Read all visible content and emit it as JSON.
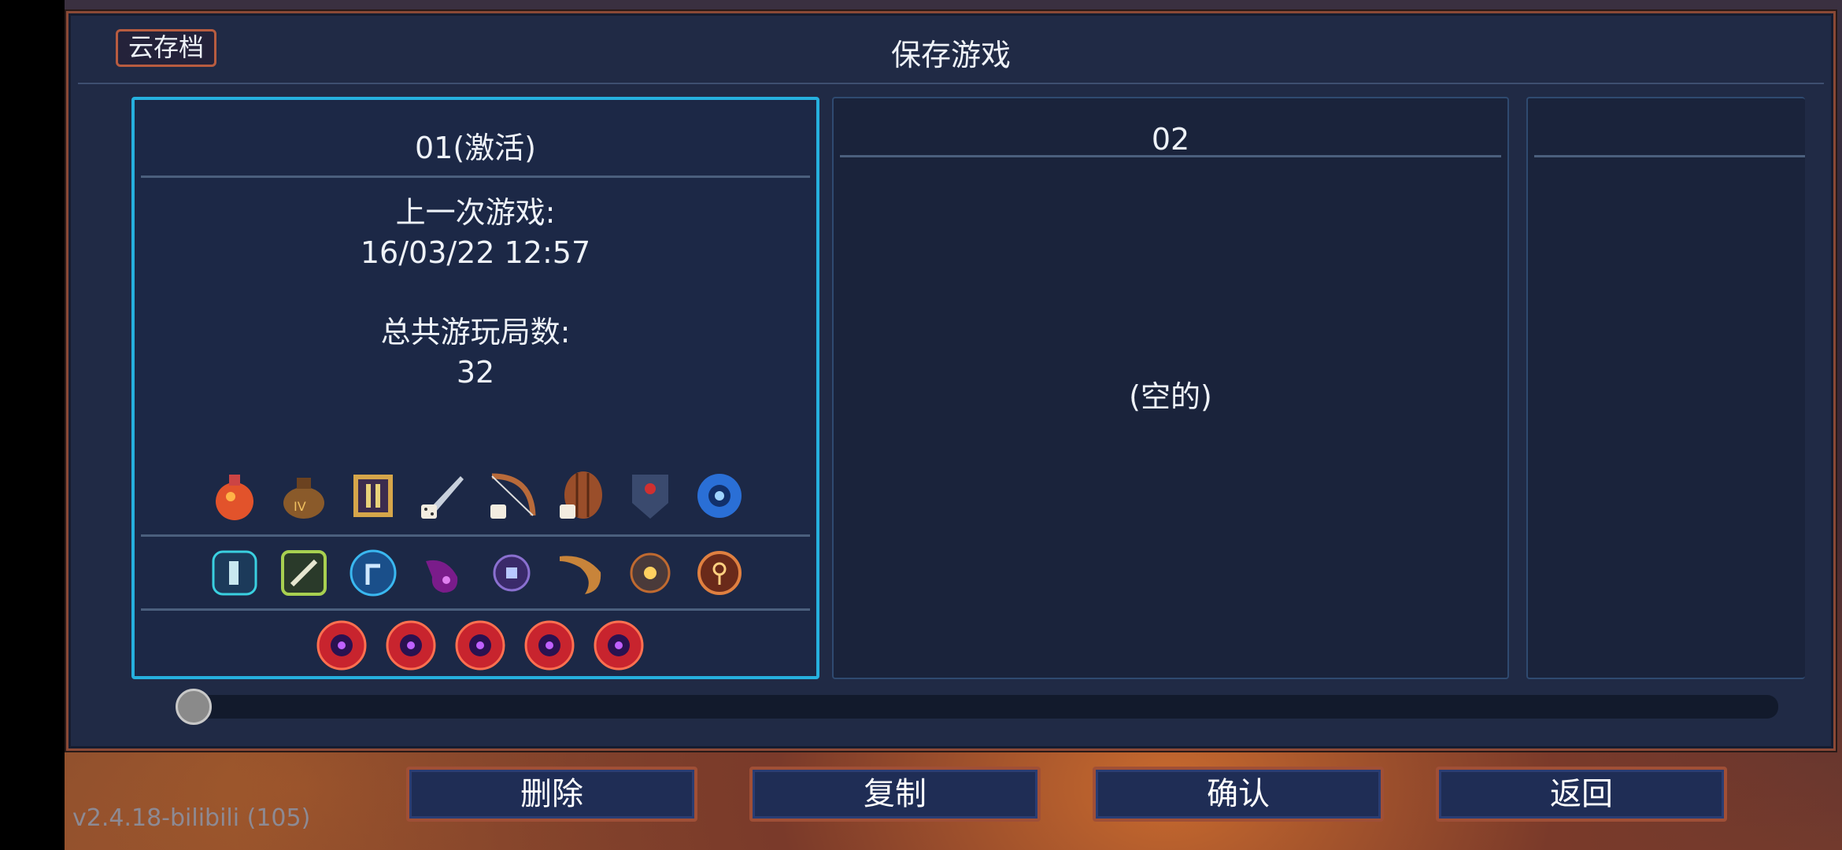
{
  "header": {
    "cloud_save_label": "云存档",
    "title": "保存游戏"
  },
  "slots": [
    {
      "title": "01(激活)",
      "last_played_label": "上一次游戏:",
      "last_played_value": "16/03/22  12:57",
      "total_runs_label": "总共游玩局数:",
      "total_runs_value": "32",
      "row1_icons": [
        "flask-icon",
        "money-bag-icon",
        "scroll-icon",
        "dagger-icon",
        "bow-icon",
        "shield-icon",
        "armor-icon",
        "eye-rune-icon"
      ],
      "row2_icons": [
        "vine-rune-icon",
        "wrench-rune-icon",
        "teleport-rune-icon",
        "hook-icon",
        "spider-rune-icon",
        "horn-icon",
        "spider-icon",
        "key-rune-icon"
      ],
      "row3_icons": [
        "boss-cell-icon",
        "boss-cell-icon",
        "boss-cell-icon",
        "boss-cell-icon",
        "boss-cell-icon"
      ]
    },
    {
      "title": "02",
      "empty_label": "(空的)"
    },
    {
      "title": ""
    }
  ],
  "buttons": {
    "delete": "删除",
    "copy": "复制",
    "confirm": "确认",
    "back": "返回"
  },
  "version": "v2.4.18-bilibili (105)",
  "colors": {
    "accent": "#26b0de",
    "frame": "#8a4936",
    "button_border": "#a04f36"
  }
}
